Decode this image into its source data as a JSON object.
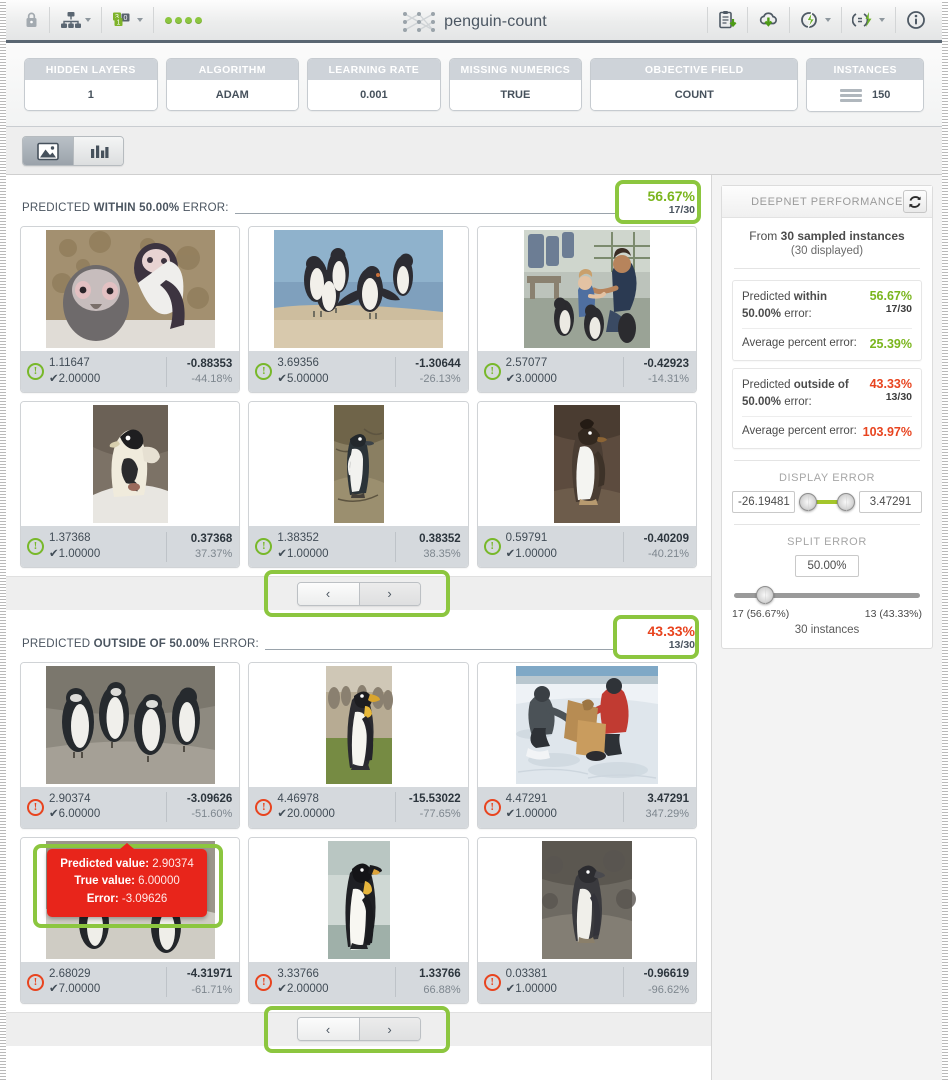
{
  "toolbar": {
    "left_icons": [
      {
        "name": "lock-icon",
        "glyph": "lock"
      },
      {
        "name": "network-icon",
        "glyph": "sitemap"
      },
      {
        "name": "dataset-icon",
        "glyph": "dataset"
      }
    ],
    "status_dots": 4,
    "title": "penguin-count",
    "right_icons": [
      {
        "name": "clipboard-download-icon",
        "glyph": "clipboard"
      },
      {
        "name": "cloud-download-icon",
        "glyph": "cloud"
      },
      {
        "name": "flash-action-icon",
        "glyph": "flash"
      },
      {
        "name": "batch-prediction-icon",
        "glyph": "batch"
      },
      {
        "name": "info-icon",
        "glyph": "info"
      }
    ]
  },
  "config": [
    {
      "label": "HIDDEN LAYERS",
      "value": "1"
    },
    {
      "label": "ALGORITHM",
      "value": "ADAM"
    },
    {
      "label": "LEARNING RATE",
      "value": "0.001"
    },
    {
      "label": "MISSING NUMERICS",
      "value": "TRUE"
    },
    {
      "label": "OBJECTIVE FIELD",
      "value": "COUNT"
    },
    {
      "label": "INSTANCES",
      "value": "150",
      "icon": "list-icon"
    }
  ],
  "view_tabs": [
    {
      "name": "tab-images",
      "icon": "image-icon",
      "active": true
    },
    {
      "name": "tab-chart",
      "icon": "bar-chart-icon",
      "active": false
    }
  ],
  "sections": [
    {
      "id": "within",
      "title_prefix": "PREDICTED ",
      "title_strong": "WITHIN 50.00%",
      "title_suffix": " ERROR:",
      "percent": "56.67%",
      "fraction": "17/30",
      "percent_color": "#7ab51d",
      "cards": [
        {
          "predicted": "1.11647",
          "truth": "2.00000",
          "abs": "-0.88353",
          "pct": "-44.18%",
          "status": "ok",
          "photo": "penguins-closeup"
        },
        {
          "predicted": "3.69356",
          "truth": "5.00000",
          "abs": "-1.30644",
          "pct": "-26.13%",
          "status": "ok",
          "photo": "penguins-beach"
        },
        {
          "predicted": "2.57077",
          "truth": "3.00000",
          "abs": "-0.42923",
          "pct": "-14.31%",
          "status": "ok",
          "photo": "zoo-visitors"
        },
        {
          "predicted": "1.37368",
          "truth": "1.00000",
          "abs": "0.37368",
          "pct": "37.37%",
          "status": "ok",
          "photo": "adelie-marked"
        },
        {
          "predicted": "1.38352",
          "truth": "1.00000",
          "abs": "0.38352",
          "pct": "38.35%",
          "status": "ok",
          "photo": "magellanic-burrow"
        },
        {
          "predicted": "0.59791",
          "truth": "1.00000",
          "abs": "-0.40209",
          "pct": "-40.21%",
          "status": "ok",
          "photo": "rockhopper"
        }
      ],
      "pager": {
        "prev": "‹",
        "next": "›",
        "active": "next"
      }
    },
    {
      "id": "outside",
      "title_prefix": "PREDICTED ",
      "title_strong": "OUTSIDE OF 50.00%",
      "title_suffix": " ERROR:",
      "percent": "43.33%",
      "fraction": "13/30",
      "percent_color": "#e8441f",
      "cards": [
        {
          "predicted": "2.90374",
          "truth": "6.00000",
          "abs": "-3.09626",
          "pct": "-51.60%",
          "status": "err",
          "photo": "penguin-group-rock"
        },
        {
          "predicted": "4.46978",
          "truth": "20.00000",
          "abs": "-15.53022",
          "pct": "-77.65%",
          "status": "err",
          "photo": "king-penguin-grass"
        },
        {
          "predicted": "4.47291",
          "truth": "1.00000",
          "abs": "3.47291",
          "pct": "347.29%",
          "status": "err",
          "photo": "researchers-snow"
        },
        {
          "predicted": "2.68029",
          "truth": "7.00000",
          "abs": "-4.31971",
          "pct": "-61.71%",
          "status": "err",
          "photo": "penguin-colony"
        },
        {
          "predicted": "3.33766",
          "truth": "2.00000",
          "abs": "1.33766",
          "pct": "66.88%",
          "status": "err",
          "photo": "emperor-penguin"
        },
        {
          "predicted": "0.03381",
          "truth": "1.00000",
          "abs": "-0.96619",
          "pct": "-96.62%",
          "status": "err",
          "photo": "penguin-rocks"
        }
      ],
      "pager": {
        "prev": "‹",
        "next": "›",
        "active": "next"
      }
    }
  ],
  "tooltip": {
    "predicted_label": "Predicted value:",
    "predicted_value": "2.90374",
    "true_label": "True value:",
    "true_value": "6.00000",
    "error_label": "Error:",
    "error_value": "-3.09626"
  },
  "sidebar": {
    "panel_title": "DEEPNET PERFORMANCE",
    "refresh_icon": "refresh-icon",
    "from_prefix": "From ",
    "from_strong": "30 sampled instances",
    "displayed": "(30 displayed)",
    "stats": [
      {
        "label_pre": "Predicted ",
        "label_strong": "within",
        "label_line2_strong": "50.00%",
        "label_line2_post": " error:",
        "value": "56.67%",
        "sub": "17/30",
        "avg_label": "Average percent error:",
        "avg_value": "25.39%",
        "color": "#7ab51d"
      },
      {
        "label_pre": "Predicted ",
        "label_strong": "outside of",
        "label_line2_strong": "50.00%",
        "label_line2_post": " error:",
        "value": "43.33%",
        "sub": "13/30",
        "avg_label": "Average percent error:",
        "avg_value": "103.97%",
        "color": "#e8441f"
      }
    ],
    "display_error": {
      "title": "DISPLAY ERROR",
      "min": "-26.19481",
      "max": "3.47291"
    },
    "split_error": {
      "title": "SPLIT ERROR",
      "value": "50.00%",
      "left_label": "17 (56.67%)",
      "right_label": "13 (43.33%)",
      "total": "30 instances"
    }
  },
  "colors": {
    "accent_green": "#8cc63f",
    "error_red": "#e8441f",
    "ok_green": "#7ab51d"
  }
}
